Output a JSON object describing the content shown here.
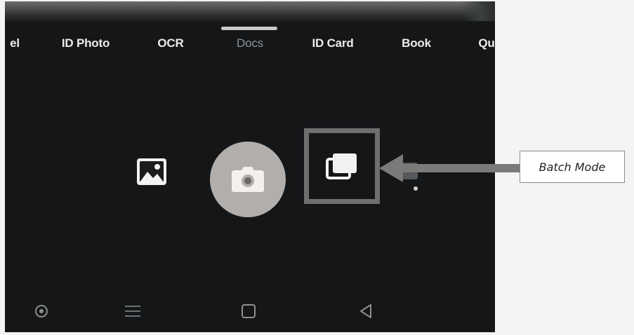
{
  "modes": {
    "tabs": [
      {
        "label": "el"
      },
      {
        "label": "ID Photo"
      },
      {
        "label": "OCR"
      },
      {
        "label": "Docs"
      },
      {
        "label": "ID Card"
      },
      {
        "label": "Book"
      },
      {
        "label": "Qu"
      }
    ],
    "active_tab": "Docs"
  },
  "controls": {
    "gallery_icon": "image-icon",
    "shutter_icon": "camera-icon",
    "batch_icon": "stacked-pages-icon"
  },
  "navigation": {
    "buttons": [
      "circle-icon",
      "menu-icon",
      "square-icon",
      "back-triangle-icon"
    ]
  },
  "annotation": {
    "label": "Batch Mode",
    "arrow_color": "#6e6f6c"
  },
  "colors": {
    "screen_bg": "#141618",
    "shutter": "#b2aeab",
    "highlight_box": "#6e6f6c",
    "active_tab": "#8f9496",
    "tab_text": "#ececec"
  }
}
